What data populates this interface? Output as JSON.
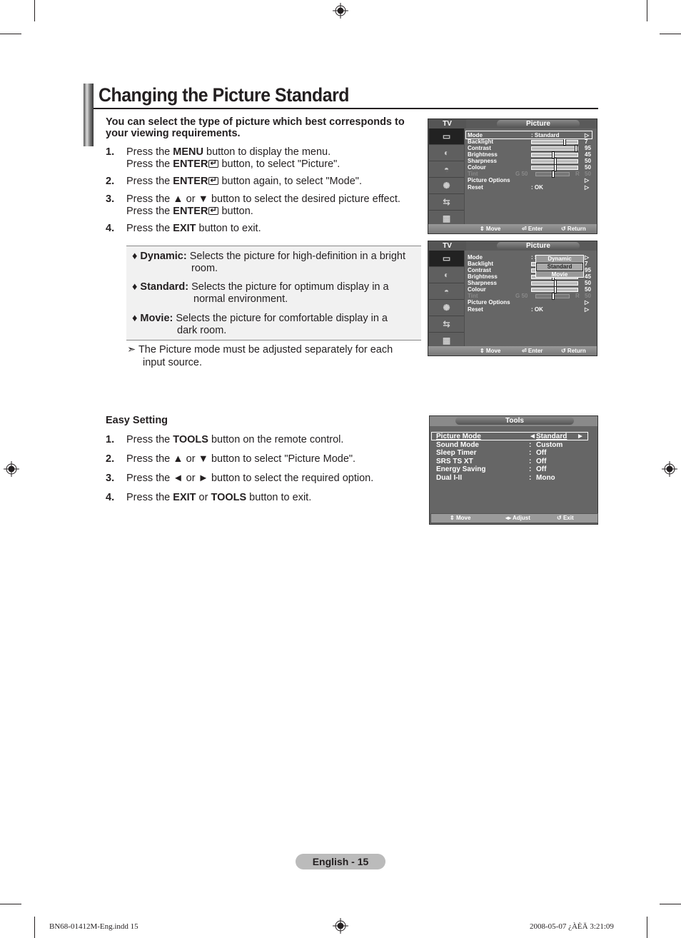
{
  "page": {
    "title": "Changing the Picture Standard",
    "intro": "You can select the type of picture which best corresponds to your viewing requirements.",
    "steps": [
      {
        "num": "1.",
        "line1_pre": "Press the ",
        "line1_bold": "MENU",
        "line1_post": " button to display the menu.",
        "line2_pre": "Press the ",
        "line2_bold": "ENTER",
        "line2_post": " button, to select \"Picture\"."
      },
      {
        "num": "2.",
        "line1_pre": "Press the ",
        "line1_bold": "ENTER",
        "line1_post": " button again, to select \"Mode\"."
      },
      {
        "num": "3.",
        "line1_pre": "Press the ▲ or ▼ button to select the desired picture effect.",
        "line2_pre": "Press the ",
        "line2_bold": "ENTER",
        "line2_post": " button."
      },
      {
        "num": "4.",
        "line1_pre": "Press the ",
        "line1_bold": "EXIT",
        "line1_post": " button to exit."
      }
    ],
    "modes": [
      {
        "name": "♦ Dynamic:",
        "desc1": "Selects the picture for high-definition in a bright",
        "desc2": "room."
      },
      {
        "name": "♦ Standard:",
        "desc1": "Selects the picture for optimum display in a",
        "desc2": "normal environment."
      },
      {
        "name": "♦ Movie:",
        "desc1": "Selects the picture for comfortable display in a",
        "desc2": "dark room."
      }
    ],
    "note_symbol": "➣",
    "note1": "The Picture mode must be adjusted separately for each",
    "note2": "input source.",
    "easy": {
      "title": "Easy Setting",
      "steps": [
        {
          "num": "1.",
          "pre": "Press the ",
          "bold": "TOOLS",
          "post": " button on the remote control."
        },
        {
          "num": "2.",
          "pre": "Press the ▲ or ▼ button to select \"Picture Mode\".",
          "bold": "",
          "post": ""
        },
        {
          "num": "3.",
          "pre": "Press the ◄ or ► button to select the required option.",
          "bold": "",
          "post": ""
        },
        {
          "num": "4.",
          "pre": "Press the ",
          "bold": "EXIT",
          "mid": " or ",
          "bold2": "TOOLS",
          "post": " button to exit."
        }
      ]
    },
    "footer": {
      "page_label": "English - 15",
      "slug_left": "BN68-01412M-Eng.indd   15",
      "slug_right": "2008-05-07   ¿ÀÈÄ 3:21:09"
    }
  },
  "osd_picture": {
    "tv_label": "TV",
    "menu_title": "Picture",
    "rows": [
      {
        "label": "Mode",
        "value": ": Standard",
        "arrow": "▷"
      },
      {
        "label": "Backlight",
        "value": "7",
        "level": 0.7
      },
      {
        "label": "Contrast",
        "value": "95",
        "level": 0.95
      },
      {
        "label": "Brightness",
        "value": "45",
        "level": 0.45
      },
      {
        "label": "Sharpness",
        "value": "50",
        "level": 0.5
      },
      {
        "label": "Colour",
        "value": "50",
        "level": 0.5
      },
      {
        "label": "Tint",
        "left": "G  50",
        "right": "R",
        "value": "50",
        "level": 0.5
      },
      {
        "label": "Picture Options",
        "arrow": "▷"
      },
      {
        "label": "Reset",
        "value": ": OK",
        "arrow": "▷"
      }
    ],
    "footer": {
      "move": "Move",
      "enter": "Enter",
      "return": "Return"
    },
    "dropdown": [
      "Dynamic",
      "Standard",
      "Movie"
    ],
    "dropdown_selected": "Standard"
  },
  "osd_tools": {
    "title": "Tools",
    "rows": [
      {
        "label": "Picture Mode",
        "sep": "◄",
        "value": "Standard",
        "arrow": "►"
      },
      {
        "label": "Sound Mode",
        "sep": ":",
        "value": "Custom"
      },
      {
        "label": "Sleep Timer",
        "sep": ":",
        "value": "Off"
      },
      {
        "label": "SRS TS XT",
        "sep": ":",
        "value": "Off"
      },
      {
        "label": "Energy Saving",
        "sep": ":",
        "value": "Off"
      },
      {
        "label": "Dual I-II",
        "sep": ":",
        "value": "Mono"
      }
    ],
    "footer": {
      "move": "Move",
      "adjust": "Adjust",
      "exit": "Exit"
    }
  }
}
